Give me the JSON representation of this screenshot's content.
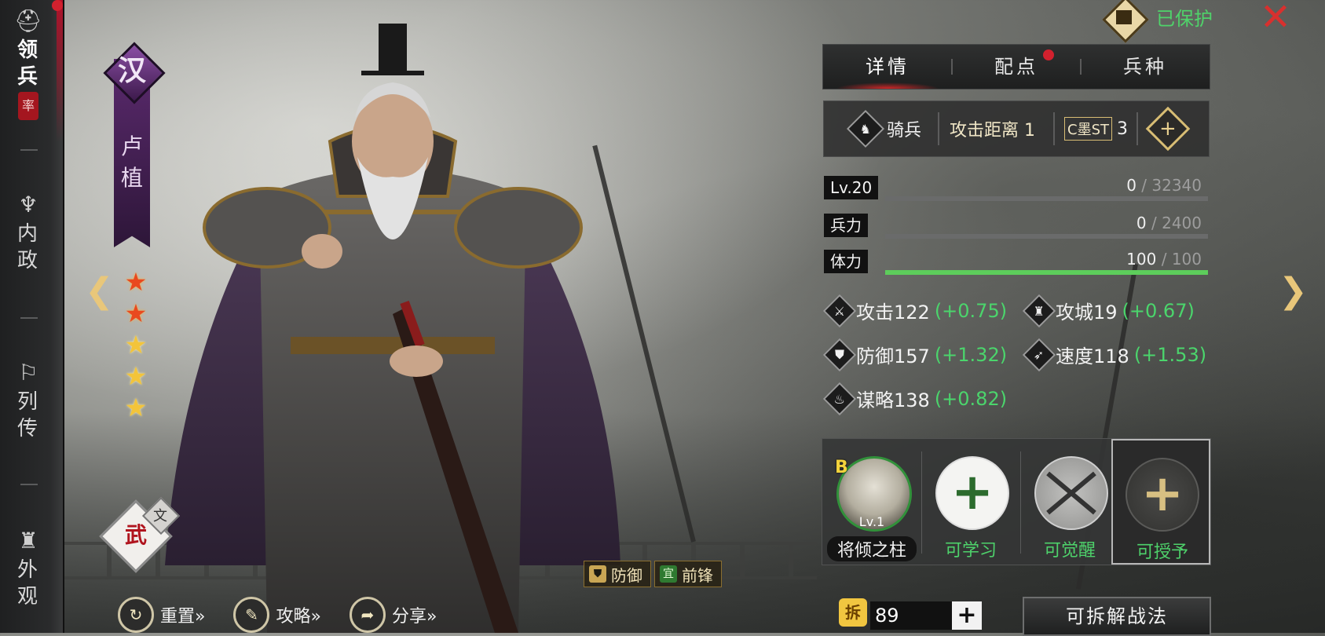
{
  "nav": {
    "items": [
      {
        "label": "领兵",
        "icon": "helmet-icon",
        "active": true,
        "seal": "率"
      },
      {
        "label": "内政",
        "icon": "fountain-icon",
        "active": false
      },
      {
        "label": "列传",
        "icon": "scroll-icon",
        "active": false
      },
      {
        "label": "外观",
        "icon": "armor-icon",
        "active": false
      }
    ]
  },
  "hero": {
    "faction": "汉",
    "name": "卢植",
    "stars_total": 5,
    "stars_awakened": 2,
    "type_main": "武",
    "type_sub": "文",
    "tags": [
      {
        "icon_text": "",
        "label": "防御"
      },
      {
        "icon_text": "宜",
        "label": "前锋"
      }
    ]
  },
  "bottom_actions": [
    {
      "label": "重置»",
      "icon": "reset-icon"
    },
    {
      "label": "攻略»",
      "icon": "guide-icon"
    },
    {
      "label": "分享»",
      "icon": "share-icon"
    }
  ],
  "protect": {
    "label": "已保护",
    "color": "#4fd36a"
  },
  "tabs": [
    {
      "label": "详情",
      "active": true
    },
    {
      "label": "配点",
      "active": false,
      "dot": true
    },
    {
      "label": "兵种",
      "active": false
    }
  ],
  "unit": {
    "type": "骑兵",
    "range_label": "攻击距离 1",
    "cost_icon_text": "C墨ST",
    "cost": "3"
  },
  "stats": [
    {
      "label": "Lv.20",
      "current": "0",
      "max": " / 32340",
      "fraction": 0.0
    },
    {
      "label": "兵力",
      "current": "0",
      "max": " / 2400",
      "fraction": 0.0
    },
    {
      "label": "体力",
      "current": "100",
      "max": " / 100",
      "fraction": 1.0
    }
  ],
  "attributes": [
    {
      "name": "攻击122",
      "bonus": "(+0.75)",
      "icon": "sword-icon"
    },
    {
      "name": "攻城19 ",
      "bonus": "(+0.67)",
      "icon": "castle-icon"
    },
    {
      "name": "防御157",
      "bonus": "(+1.32)",
      "icon": "shield-icon"
    },
    {
      "name": "速度118",
      "bonus": "(+1.53)",
      "icon": "boot-icon"
    },
    {
      "name": "谋略138",
      "bonus": "(+0.82)",
      "icon": "flame-icon"
    }
  ],
  "skills": [
    {
      "grade": "B",
      "level": "Lv.1",
      "caption": "将倾之柱",
      "style": "badge"
    },
    {
      "caption": "可学习",
      "style": "plain"
    },
    {
      "caption": "可觉醒",
      "style": "plain"
    },
    {
      "caption": "可授予",
      "style": "plain"
    }
  ],
  "currency": {
    "icon_text": "拆",
    "amount": "89",
    "plus": "+"
  },
  "disassemble_label": "可拆解战法",
  "colors": {
    "accent_red": "#d2212e",
    "bonus_green": "#4bd56c",
    "gold": "#e9c77a",
    "faction_purple": "#5b2a6e"
  }
}
